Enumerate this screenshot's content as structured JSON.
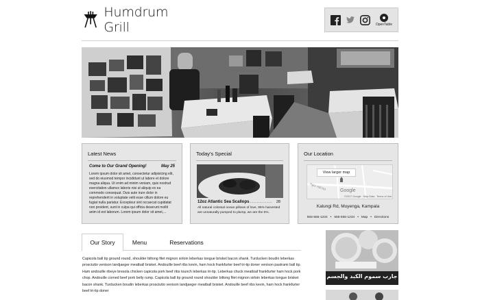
{
  "header": {
    "brand": "Humdrum Grill",
    "social": {
      "facebook_icon": "facebook-icon",
      "twitter_icon": "twitter-icon",
      "instagram_icon": "instagram-icon",
      "opentable_label": "OpenTable"
    }
  },
  "news": {
    "title": "Latest News",
    "headline": "Come to Our Grand Opening!",
    "date": "May 25",
    "body": "Lorem ipsum dolor sit amet, consectetur adipisicing elit, sed do eiusmod tempor incididunt ut labore et dolore magna aliqua. Ut enim ad minim veniam, quis nostrud exercitation ullamco laboris nisi ut aliquip ex ea commodo consequat. Duis aute irure dolor in reprehenderit in voluptate velit esse cillum dolore eu fugiat nulla pariatur. Excepteur sint occaecat cupidatat non proident, sunt in culpa qui officia deserunt mollit anim id est laborum. Lorem ipsum dolor sit amet,..."
  },
  "special": {
    "title": "Today's Special",
    "dish": "12oz Atlantic Sea Scallops",
    "leader": "........................",
    "price": "28",
    "body": "All natural colossal ocean pillows of love, 95% harvested are unnaturally pumped to plump, we are the 5%."
  },
  "location": {
    "title": "Our Location",
    "map_button": "View larger map",
    "map_road": "Tiger Hill Rd",
    "map_logo": "Google",
    "map_attribution": "©2017 Google · Map Data",
    "map_terms": "Terms of Use",
    "address": "Kalungi Rd, Muyenga, Kampala",
    "phone1": "555-555-1234",
    "phone2": "555-555-1234",
    "map_link": "Map",
    "directions_link": "Directions"
  },
  "tabs": [
    {
      "label": "Our Story"
    },
    {
      "label": "Menu"
    },
    {
      "label": "Reservations"
    }
  ],
  "story": "Capicola ball tip ground round, shoulder biltong filet mignon sirloin leberkas tongue brisket bacon shank. Turducken boudin leberkas prosciutto venison landjaeger meatball brisket. Andouille beef ribs kevin, ham hock frankfurter beef tri-tip doner venison pastrami ball tip. Ham andouille ribeye bresola chicken capicola pork beef ribs tounch leberkas tri-tip. Leberkas chuck meatloaf frankfurter ham hock pork chop. Andouille corned beef pork belly rump. Capicola ball tip ground round shoulder biltong filet mignon sirloin leberkas tongue brisket bacon shank. Turducken boudin leberkas prosciutto venison landjaeger meatball brisket. Andouille beef ribs kevin, ham hock frankfurter beef tri-tip doner",
  "ad": {
    "arabic_text": "جارب سموم الكبد والجسم"
  }
}
